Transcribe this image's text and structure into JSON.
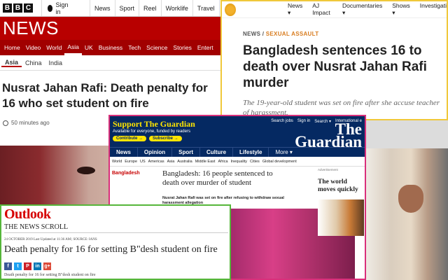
{
  "bbc": {
    "logo_letters": [
      "B",
      "B",
      "C"
    ],
    "sign_in": "Sign in",
    "top_links": [
      "News",
      "Sport",
      "Reel",
      "Worklife",
      "Travel",
      "Fu"
    ],
    "brand": "NEWS",
    "nav": [
      "Home",
      "Video",
      "World",
      "Asia",
      "UK",
      "Business",
      "Tech",
      "Science",
      "Stories",
      "Entert"
    ],
    "nav_active": "Asia",
    "subnav": [
      "Asia",
      "China",
      "India"
    ],
    "headline": "Nusrat Jahan Rafi: Death penalty for 16 who set student on fire",
    "timestamp": "50 minutes ago",
    "colors": {
      "brand_red": "#b80000",
      "nav_red": "#a10000"
    }
  },
  "aljazeera": {
    "nav": [
      "News ▾",
      "AJ Impact",
      "Documentaries ▾",
      "Shows ▾",
      "Investigati"
    ],
    "tag_section": "NEWS",
    "tag_separator": " / ",
    "tag_topic": "SEXUAL ASSAULT",
    "headline": "Bangladesh sentences 16 to death over Nusrat Jahan Rafi murder",
    "standfirst": "The 19-year-old student was set on fire after she accuse teacher of harassment.",
    "colors": {
      "border": "#f0c83a",
      "topic": "#d87c1f"
    }
  },
  "guardian": {
    "support": "Support The Guardian",
    "funded": "Available for everyone, funded by readers",
    "contribute": "Contribute →",
    "subscribe": "Subscribe →",
    "mast_links": [
      "Search jobs",
      "Sign in",
      "Search ▾",
      "International e"
    ],
    "brand_line1": "The",
    "brand_line2": "Guardian",
    "nav": [
      "News",
      "Opinion",
      "Sport",
      "Culture",
      "Lifestyle"
    ],
    "nav_more": "More ▾",
    "subnav": [
      "World",
      "Europe",
      "US",
      "Americas",
      "Asia",
      "Australia",
      "Middle East",
      "Africa",
      "Inequality",
      "Cities",
      "Global development"
    ],
    "section": "Bangladesh",
    "headline": "Bangladesh: 16 people sentenced to death over murder of student",
    "standfirst": "Nusrat Jahan Rafi was set on fire after refusing to withdraw sexual harassment allegation",
    "ad_label": "Advertisement",
    "ad_title": "The world moves quickly",
    "colors": {
      "navy": "#052962",
      "yellow": "#ffe500",
      "border": "#d9307b",
      "section_red": "#c70000"
    }
  },
  "outlook": {
    "logo": "Outlook",
    "section": "THE NEWS SCROLL",
    "meta": "24 OCTOBER 2019   Last Updated at 11:36 AM | SOURCE: IANS",
    "headline": "Death penalty for 16 for setting B\"desh student on fire",
    "share_icons": [
      {
        "name": "facebook-icon",
        "glyph": "f",
        "color": "#3b5998"
      },
      {
        "name": "twitter-icon",
        "glyph": "t",
        "color": "#1da1f2"
      },
      {
        "name": "pinterest-icon",
        "glyph": "P",
        "color": "#cb2027"
      },
      {
        "name": "linkedin-icon",
        "glyph": "in",
        "color": "#0077b5"
      },
      {
        "name": "googleplus-icon",
        "glyph": "g+",
        "color": "#dd4b39"
      }
    ],
    "caption": "Death penalty for 16 for setting B\"desh student on fire",
    "colors": {
      "logo_red": "#d60000",
      "border": "#56b63a"
    }
  }
}
